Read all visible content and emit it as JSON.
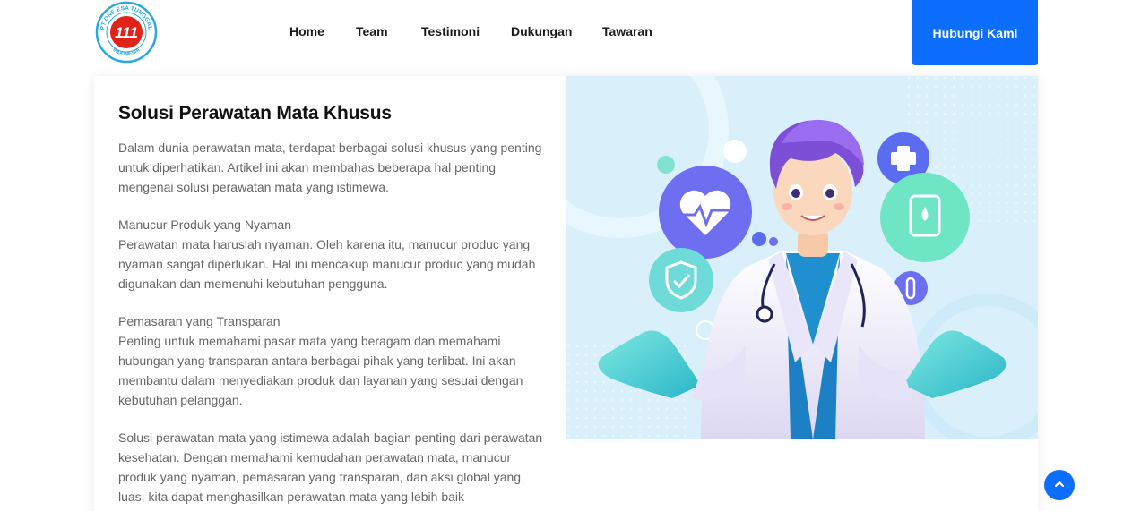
{
  "nav": {
    "logo": {
      "ring_top": "PT ONE ESA TUNGGAL",
      "ring_bottom": "INDONESIA",
      "mark": "111"
    },
    "items": [
      "Home",
      "Team",
      "Testimoni",
      "Dukungan",
      "Tawaran"
    ],
    "cta_label": "Hubungi Kami"
  },
  "article": {
    "title": "Solusi Perawatan Mata Khusus",
    "intro": "Dalam dunia perawatan mata, terdapat berbagai solusi khusus yang penting untuk diperhatikan. Artikel ini akan membahas beberapa hal penting mengenai solusi perawatan mata yang istimewa.",
    "section1_heading": "Manucur Produk yang Nyaman",
    "section1_body": "Perawatan mata haruslah nyaman. Oleh karena itu, manucur produc yang nyaman sangat diperlukan. Hal ini mencakup manucur produc yang mudah digunakan dan memenuhi kebutuhan pengguna.",
    "section2_heading": "Pemasaran yang Transparan",
    "section2_body": "Penting untuk memahami pasar mata yang beragam dan memahami hubungan yang transparan antara berbagai pihak yang terlibat. Ini akan membantu dalam menyediakan produk dan layanan yang sesuai dengan kebutuhan pelanggan.",
    "conclusion": "Solusi perawatan mata yang istimewa adalah bagian penting dari perawatan kesehatan. Dengan memahami kemudahan perawatan mata, manucur produk yang nyaman, pemasaran yang transparan, dan aksi global yang luas, kita dapat menghasilkan perawatan mata yang lebih baik"
  },
  "icons": {
    "logo": "company-logo",
    "scroll_top": "chevron-up-icon",
    "hero": "doctor-illustration"
  },
  "colors": {
    "primary": "#0d6efd",
    "logo_red": "#e2231a",
    "logo_blue": "#29a8e0",
    "hero_bg": "#d9f0fb"
  }
}
